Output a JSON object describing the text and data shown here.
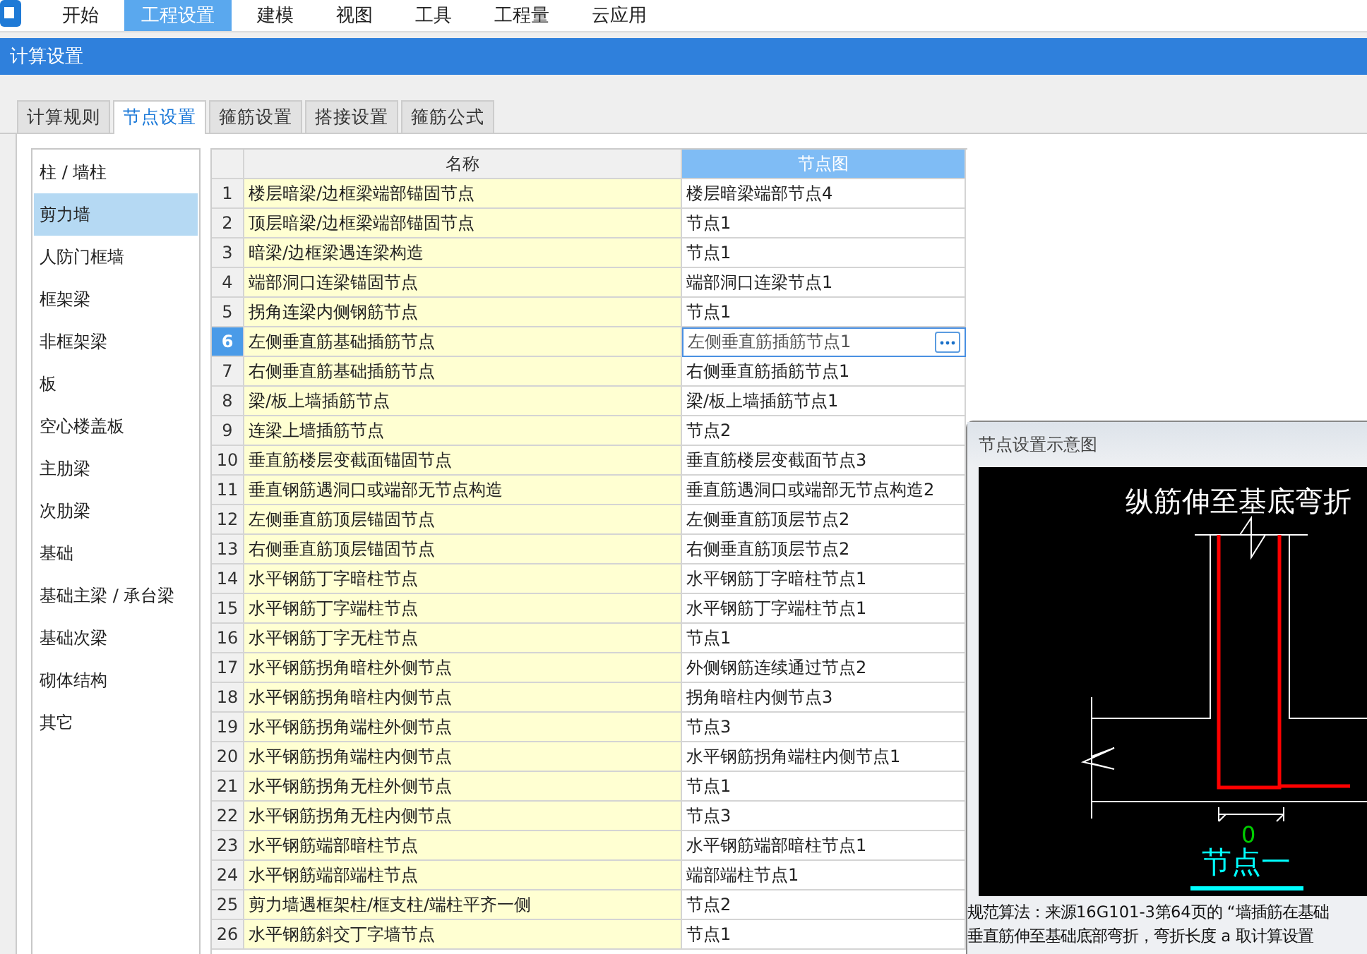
{
  "menu": [
    {
      "label": "开始",
      "selected": false
    },
    {
      "label": "工程设置",
      "selected": true
    },
    {
      "label": "建模",
      "selected": false
    },
    {
      "label": "视图",
      "selected": false
    },
    {
      "label": "工具",
      "selected": false
    },
    {
      "label": "工程量",
      "selected": false
    },
    {
      "label": "云应用",
      "selected": false
    }
  ],
  "panel_title": "计算设置",
  "tabs": [
    {
      "label": "计算规则",
      "selected": false
    },
    {
      "label": "节点设置",
      "selected": true
    },
    {
      "label": "箍筋设置",
      "selected": false
    },
    {
      "label": "搭接设置",
      "selected": false
    },
    {
      "label": "箍筋公式",
      "selected": false
    }
  ],
  "categories": [
    {
      "label": "柱 / 墙柱",
      "selected": false
    },
    {
      "label": "剪力墙",
      "selected": true
    },
    {
      "label": "人防门框墙",
      "selected": false
    },
    {
      "label": "框架梁",
      "selected": false
    },
    {
      "label": "非框架梁",
      "selected": false
    },
    {
      "label": "板",
      "selected": false
    },
    {
      "label": "空心楼盖板",
      "selected": false
    },
    {
      "label": "主肋梁",
      "selected": false
    },
    {
      "label": "次肋梁",
      "selected": false
    },
    {
      "label": "基础",
      "selected": false
    },
    {
      "label": "基础主梁 / 承台梁",
      "selected": false
    },
    {
      "label": "基础次梁",
      "selected": false
    },
    {
      "label": "砌体结构",
      "selected": false
    },
    {
      "label": "其它",
      "selected": false
    }
  ],
  "table": {
    "columns": [
      {
        "label": "名称",
        "selected": false
      },
      {
        "label": "节点图",
        "selected": true
      }
    ],
    "rows": [
      {
        "number": "1",
        "name": "楼层暗梁/边框梁端部锚固节点",
        "node": "楼层暗梁端部节点4",
        "selected": false
      },
      {
        "number": "2",
        "name": "顶层暗梁/边框梁端部锚固节点",
        "node": "节点1",
        "selected": false
      },
      {
        "number": "3",
        "name": "暗梁/边框梁遇连梁构造",
        "node": "节点1",
        "selected": false
      },
      {
        "number": "4",
        "name": "端部洞口连梁锚固节点",
        "node": "端部洞口连梁节点1",
        "selected": false
      },
      {
        "number": "5",
        "name": "拐角连梁内侧钢筋节点",
        "node": "节点1",
        "selected": false
      },
      {
        "number": "6",
        "name": "左侧垂直筋基础插筋节点",
        "node": "左侧垂直筋插筋节点1",
        "selected": true
      },
      {
        "number": "7",
        "name": "右侧垂直筋基础插筋节点",
        "node": "右侧垂直筋插筋节点1",
        "selected": false
      },
      {
        "number": "8",
        "name": "梁/板上墙插筋节点",
        "node": "梁/板上墙插筋节点1",
        "selected": false
      },
      {
        "number": "9",
        "name": "连梁上墙插筋节点",
        "node": "节点2",
        "selected": false
      },
      {
        "number": "10",
        "name": "垂直筋楼层变截面锚固节点",
        "node": "垂直筋楼层变截面节点3",
        "selected": false
      },
      {
        "number": "11",
        "name": "垂直钢筋遇洞口或端部无节点构造",
        "node": "垂直筋遇洞口或端部无节点构造2",
        "selected": false
      },
      {
        "number": "12",
        "name": "左侧垂直筋顶层锚固节点",
        "node": "左侧垂直筋顶层节点2",
        "selected": false
      },
      {
        "number": "13",
        "name": "右侧垂直筋顶层锚固节点",
        "node": "右侧垂直筋顶层节点2",
        "selected": false
      },
      {
        "number": "14",
        "name": "水平钢筋丁字暗柱节点",
        "node": "水平钢筋丁字暗柱节点1",
        "selected": false
      },
      {
        "number": "15",
        "name": "水平钢筋丁字端柱节点",
        "node": "水平钢筋丁字端柱节点1",
        "selected": false
      },
      {
        "number": "16",
        "name": "水平钢筋丁字无柱节点",
        "node": "节点1",
        "selected": false
      },
      {
        "number": "17",
        "name": "水平钢筋拐角暗柱外侧节点",
        "node": "外侧钢筋连续通过节点2",
        "selected": false
      },
      {
        "number": "18",
        "name": "水平钢筋拐角暗柱内侧节点",
        "node": "拐角暗柱内侧节点3",
        "selected": false
      },
      {
        "number": "19",
        "name": "水平钢筋拐角端柱外侧节点",
        "node": "节点3",
        "selected": false
      },
      {
        "number": "20",
        "name": "水平钢筋拐角端柱内侧节点",
        "node": "水平钢筋拐角端柱内侧节点1",
        "selected": false
      },
      {
        "number": "21",
        "name": "水平钢筋拐角无柱外侧节点",
        "node": "节点1",
        "selected": false
      },
      {
        "number": "22",
        "name": "水平钢筋拐角无柱内侧节点",
        "node": "节点3",
        "selected": false
      },
      {
        "number": "23",
        "name": "水平钢筋端部暗柱节点",
        "node": "水平钢筋端部暗柱节点1",
        "selected": false
      },
      {
        "number": "24",
        "name": "水平钢筋端部端柱节点",
        "node": "端部端柱节点1",
        "selected": false
      },
      {
        "number": "25",
        "name": "剪力墙遇框架柱/框支柱/端柱平齐一侧",
        "node": "节点2",
        "selected": false
      },
      {
        "number": "26",
        "name": "水平钢筋斜交丁字墙节点",
        "node": "节点1",
        "selected": false
      }
    ]
  },
  "popup": {
    "title": "节点设置示意图",
    "diagram": {
      "caption": "纵筋伸至基底弯折",
      "dimension": "0",
      "node_label": "节点一"
    },
    "description": [
      "规范算法：来源16G101-3第64页的 “墙插筋在基础",
      "垂直筋伸至基础底部弯折，弯折长度 a 取计算设置"
    ]
  }
}
